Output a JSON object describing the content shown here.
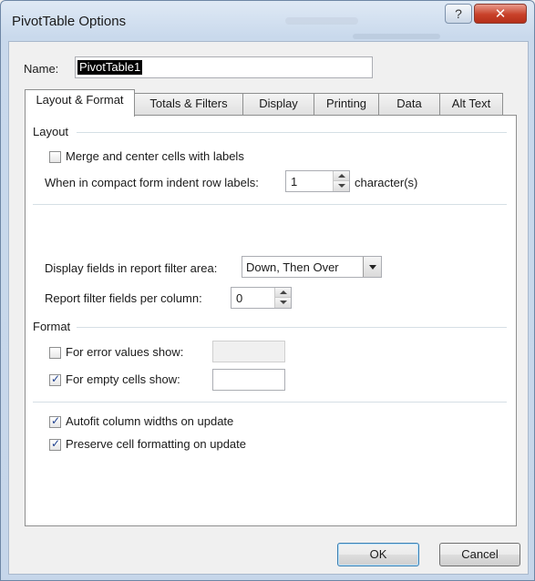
{
  "window": {
    "title": "PivotTable Options"
  },
  "name_field": {
    "label": "Name:",
    "value": "PivotTable1"
  },
  "tabs": [
    {
      "label": "Layout & Format",
      "active": true
    },
    {
      "label": "Totals & Filters",
      "active": false
    },
    {
      "label": "Display",
      "active": false
    },
    {
      "label": "Printing",
      "active": false
    },
    {
      "label": "Data",
      "active": false
    },
    {
      "label": "Alt Text",
      "active": false
    }
  ],
  "layout": {
    "heading": "Layout",
    "merge_center": {
      "label": "Merge and center cells with labels",
      "checked": false
    },
    "compact_indent": {
      "label": "When in compact form indent row labels:",
      "value": "1",
      "suffix": "character(s)"
    },
    "display_fields": {
      "label": "Display fields in report filter area:",
      "value": "Down, Then Over"
    },
    "filter_fields": {
      "label": "Report filter fields per column:",
      "value": "0"
    }
  },
  "format": {
    "heading": "Format",
    "error_values": {
      "label": "For error values show:",
      "checked": false,
      "value": ""
    },
    "empty_cells": {
      "label": "For empty cells show:",
      "checked": true,
      "value": ""
    },
    "autofit": {
      "label": "Autofit column widths on update",
      "checked": true
    },
    "preserve": {
      "label": "Preserve cell formatting on update",
      "checked": true
    }
  },
  "buttons": {
    "ok": "OK",
    "cancel": "Cancel"
  },
  "icons": {
    "help": "help-icon",
    "close": "close-icon"
  },
  "colors": {
    "accent": "#3c7fb1",
    "close": "#c8412a",
    "checkmark": "#1d3f8f"
  }
}
